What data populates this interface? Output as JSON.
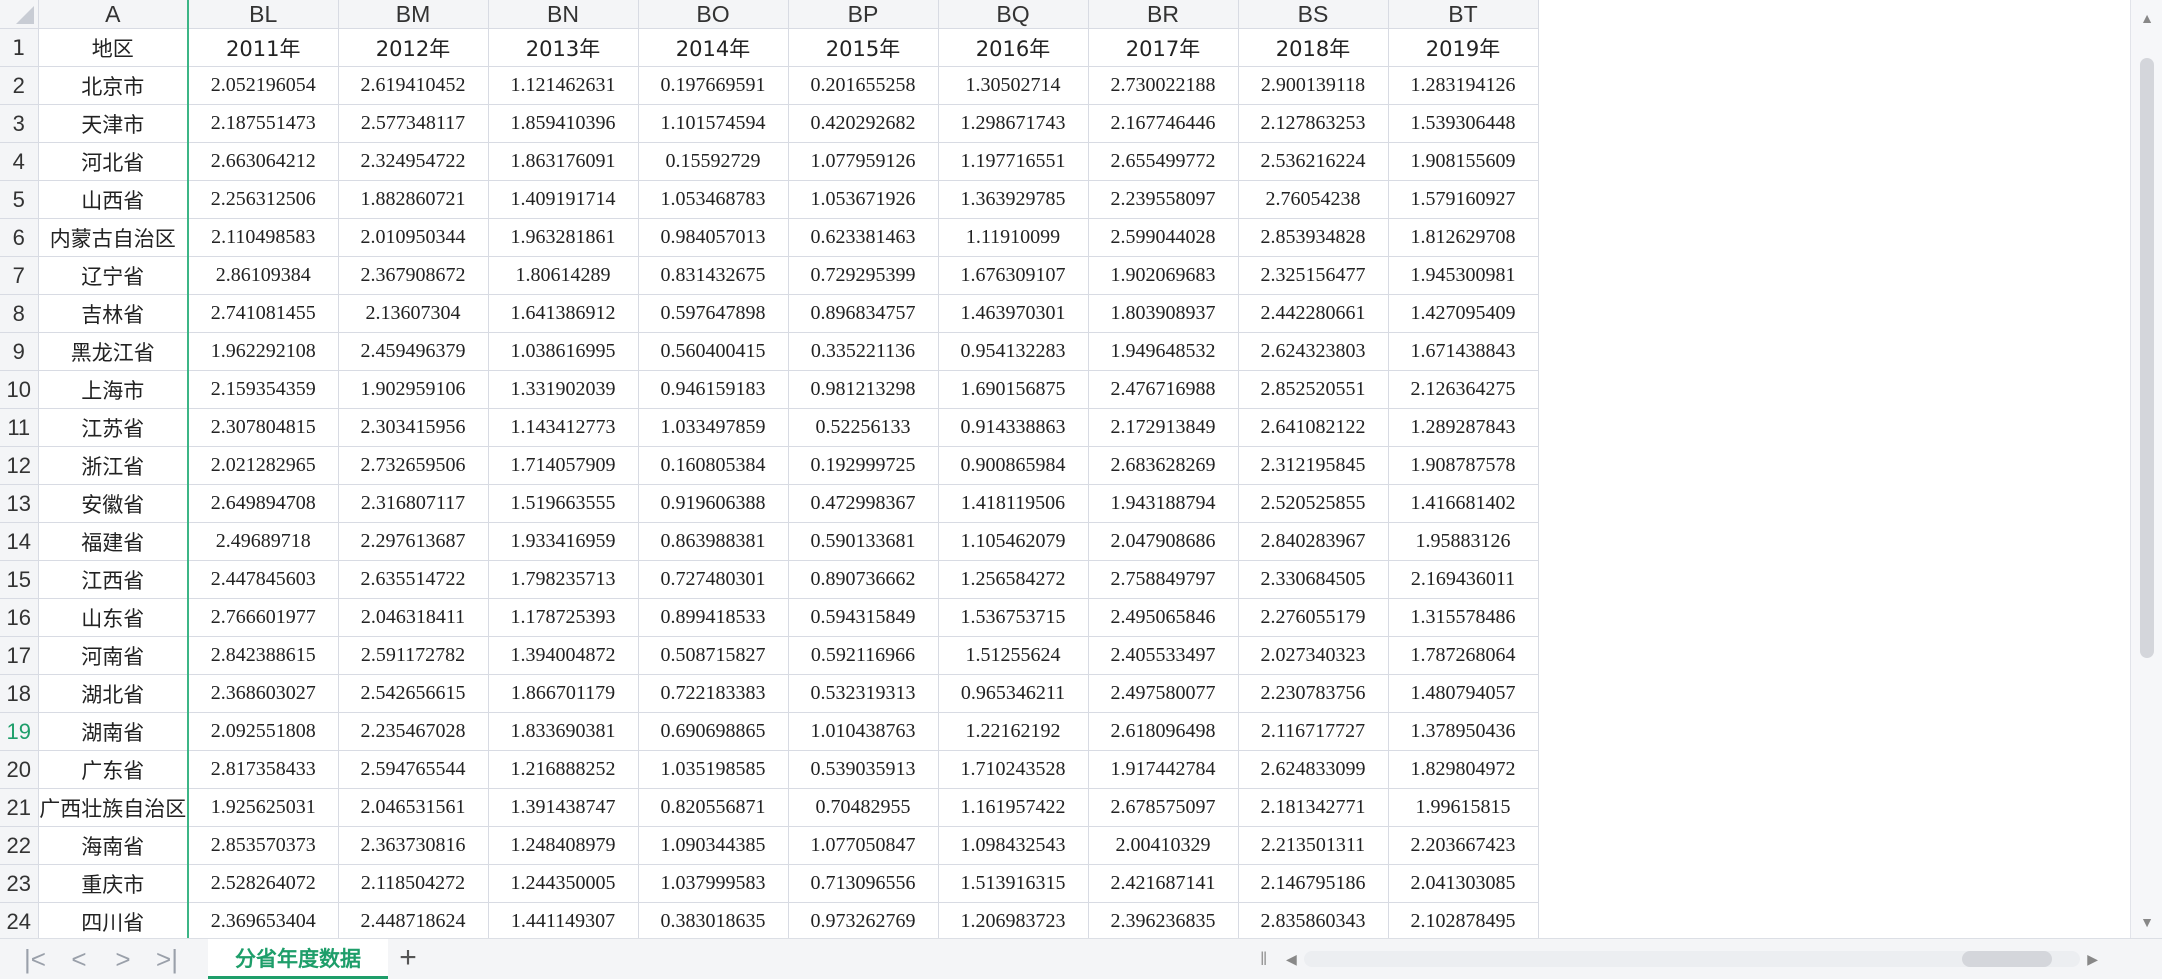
{
  "columns": [
    "A",
    "BL",
    "BM",
    "BN",
    "BO",
    "BP",
    "BQ",
    "BR",
    "BS",
    "BT"
  ],
  "active_row": 19,
  "header_row": {
    "row": 1,
    "region": "地区",
    "years": [
      "2011年",
      "2012年",
      "2013年",
      "2014年",
      "2015年",
      "2016年",
      "2017年",
      "2018年",
      "2019年"
    ]
  },
  "rows": [
    {
      "row": 2,
      "region": "北京市",
      "v": [
        "2.052196054",
        "2.619410452",
        "1.121462631",
        "0.197669591",
        "0.201655258",
        "1.30502714",
        "2.730022188",
        "2.900139118",
        "1.283194126"
      ]
    },
    {
      "row": 3,
      "region": "天津市",
      "v": [
        "2.187551473",
        "2.577348117",
        "1.859410396",
        "1.101574594",
        "0.420292682",
        "1.298671743",
        "2.167746446",
        "2.127863253",
        "1.539306448"
      ]
    },
    {
      "row": 4,
      "region": "河北省",
      "v": [
        "2.663064212",
        "2.324954722",
        "1.863176091",
        "0.15592729",
        "1.077959126",
        "1.197716551",
        "2.655499772",
        "2.536216224",
        "1.908155609"
      ]
    },
    {
      "row": 5,
      "region": "山西省",
      "v": [
        "2.256312506",
        "1.882860721",
        "1.409191714",
        "1.053468783",
        "1.053671926",
        "1.363929785",
        "2.239558097",
        "2.76054238",
        "1.579160927"
      ]
    },
    {
      "row": 6,
      "region": "内蒙古自治区",
      "v": [
        "2.110498583",
        "2.010950344",
        "1.963281861",
        "0.984057013",
        "0.623381463",
        "1.11910099",
        "2.599044028",
        "2.853934828",
        "1.812629708"
      ]
    },
    {
      "row": 7,
      "region": "辽宁省",
      "v": [
        "2.86109384",
        "2.367908672",
        "1.80614289",
        "0.831432675",
        "0.729295399",
        "1.676309107",
        "1.902069683",
        "2.325156477",
        "1.945300981"
      ]
    },
    {
      "row": 8,
      "region": "吉林省",
      "v": [
        "2.741081455",
        "2.13607304",
        "1.641386912",
        "0.597647898",
        "0.896834757",
        "1.463970301",
        "1.803908937",
        "2.442280661",
        "1.427095409"
      ]
    },
    {
      "row": 9,
      "region": "黑龙江省",
      "v": [
        "1.962292108",
        "2.459496379",
        "1.038616995",
        "0.560400415",
        "0.335221136",
        "0.954132283",
        "1.949648532",
        "2.624323803",
        "1.671438843"
      ]
    },
    {
      "row": 10,
      "region": "上海市",
      "v": [
        "2.159354359",
        "1.902959106",
        "1.331902039",
        "0.946159183",
        "0.981213298",
        "1.690156875",
        "2.476716988",
        "2.852520551",
        "2.126364275"
      ]
    },
    {
      "row": 11,
      "region": "江苏省",
      "v": [
        "2.307804815",
        "2.303415956",
        "1.143412773",
        "1.033497859",
        "0.52256133",
        "0.914338863",
        "2.172913849",
        "2.641082122",
        "1.289287843"
      ]
    },
    {
      "row": 12,
      "region": "浙江省",
      "v": [
        "2.021282965",
        "2.732659506",
        "1.714057909",
        "0.160805384",
        "0.192999725",
        "0.900865984",
        "2.683628269",
        "2.312195845",
        "1.908787578"
      ]
    },
    {
      "row": 13,
      "region": "安徽省",
      "v": [
        "2.649894708",
        "2.316807117",
        "1.519663555",
        "0.919606388",
        "0.472998367",
        "1.418119506",
        "1.943188794",
        "2.520525855",
        "1.416681402"
      ]
    },
    {
      "row": 14,
      "region": "福建省",
      "v": [
        "2.49689718",
        "2.297613687",
        "1.933416959",
        "0.863988381",
        "0.590133681",
        "1.105462079",
        "2.047908686",
        "2.840283967",
        "1.95883126"
      ]
    },
    {
      "row": 15,
      "region": "江西省",
      "v": [
        "2.447845603",
        "2.635514722",
        "1.798235713",
        "0.727480301",
        "0.890736662",
        "1.256584272",
        "2.758849797",
        "2.330684505",
        "2.169436011"
      ]
    },
    {
      "row": 16,
      "region": "山东省",
      "v": [
        "2.766601977",
        "2.046318411",
        "1.178725393",
        "0.899418533",
        "0.594315849",
        "1.536753715",
        "2.495065846",
        "2.276055179",
        "1.315578486"
      ]
    },
    {
      "row": 17,
      "region": "河南省",
      "v": [
        "2.842388615",
        "2.591172782",
        "1.394004872",
        "0.508715827",
        "0.592116966",
        "1.51255624",
        "2.405533497",
        "2.027340323",
        "1.787268064"
      ]
    },
    {
      "row": 18,
      "region": "湖北省",
      "v": [
        "2.368603027",
        "2.542656615",
        "1.866701179",
        "0.722183383",
        "0.532319313",
        "0.965346211",
        "2.497580077",
        "2.230783756",
        "1.480794057"
      ]
    },
    {
      "row": 19,
      "region": "湖南省",
      "v": [
        "2.092551808",
        "2.235467028",
        "1.833690381",
        "0.690698865",
        "1.010438763",
        "1.22162192",
        "2.618096498",
        "2.116717727",
        "1.378950436"
      ]
    },
    {
      "row": 20,
      "region": "广东省",
      "v": [
        "2.817358433",
        "2.594765544",
        "1.216888252",
        "1.035198585",
        "0.539035913",
        "1.710243528",
        "1.917442784",
        "2.624833099",
        "1.829804972"
      ]
    },
    {
      "row": 21,
      "region": "广西壮族自治区",
      "v": [
        "1.925625031",
        "2.046531561",
        "1.391438747",
        "0.820556871",
        "0.70482955",
        "1.161957422",
        "2.678575097",
        "2.181342771",
        "1.99615815"
      ]
    },
    {
      "row": 22,
      "region": "海南省",
      "v": [
        "2.853570373",
        "2.363730816",
        "1.248408979",
        "1.090344385",
        "1.077050847",
        "1.098432543",
        "2.00410329",
        "2.213501311",
        "2.203667423"
      ]
    },
    {
      "row": 23,
      "region": "重庆市",
      "v": [
        "2.528264072",
        "2.118504272",
        "1.244350005",
        "1.037999583",
        "0.713096556",
        "1.513916315",
        "2.421687141",
        "2.146795186",
        "2.041303085"
      ]
    },
    {
      "row": 24,
      "region": "四川省",
      "v": [
        "2.369653404",
        "2.448718624",
        "1.441149307",
        "0.383018635",
        "0.973262769",
        "1.206983723",
        "2.396236835",
        "2.835860343",
        "2.102878495"
      ]
    }
  ],
  "sheet_tab": "分省年度数据",
  "nav": {
    "first": "|<",
    "prev": "<",
    "next": ">",
    "last": ">|"
  },
  "add_sheet": "+",
  "colors": {
    "accent": "#1e9e6a",
    "freeze_line": "#3cb586",
    "grid": "#d8dbe3"
  }
}
